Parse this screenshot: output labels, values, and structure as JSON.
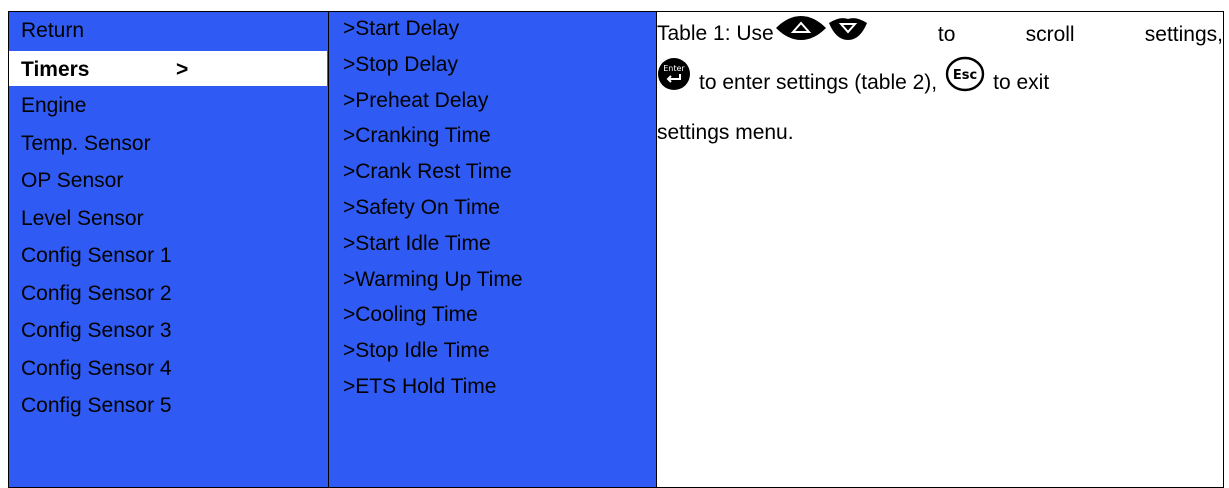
{
  "menu_column": {
    "items": [
      {
        "label": "Return",
        "selected": false
      },
      {
        "label": "Timers",
        "selected": true,
        "marker": ">"
      },
      {
        "label": "Engine",
        "selected": false
      },
      {
        "label": "Temp. Sensor",
        "selected": false
      },
      {
        "label": "OP Sensor",
        "selected": false
      },
      {
        "label": "Level Sensor",
        "selected": false
      },
      {
        "label": "Config Sensor 1",
        "selected": false
      },
      {
        "label": "Config Sensor 2",
        "selected": false
      },
      {
        "label": "Config Sensor 3",
        "selected": false
      },
      {
        "label": "Config Sensor 4",
        "selected": false
      },
      {
        "label": "Config Sensor 5",
        "selected": false
      }
    ]
  },
  "submenu_column": {
    "items": [
      ">Start Delay",
      ">Stop Delay",
      ">Preheat Delay",
      ">Cranking Time",
      ">Crank Rest Time",
      ">Safety On Time",
      ">Start Idle Time",
      ">Warming Up Time",
      ">Cooling Time",
      ">Stop Idle Time",
      ">ETS Hold Time"
    ]
  },
  "description": {
    "line1_before": "Table 1: Use",
    "line1_w1": "to",
    "line1_w2": "scroll",
    "line1_w3": "settings,",
    "line2_mid": "to enter settings (table 2),",
    "line2_end": "to exit",
    "line3": "settings menu.",
    "enter_icon_text": "Enter",
    "esc_icon_text": "Esc"
  },
  "colors": {
    "menu_background": "#2f5bf4",
    "selected_background": "#ffffff",
    "icon_fill": "#000000"
  },
  "icons": [
    "up-arrow-button-icon",
    "down-arrow-button-icon",
    "enter-button-icon",
    "esc-button-icon"
  ]
}
